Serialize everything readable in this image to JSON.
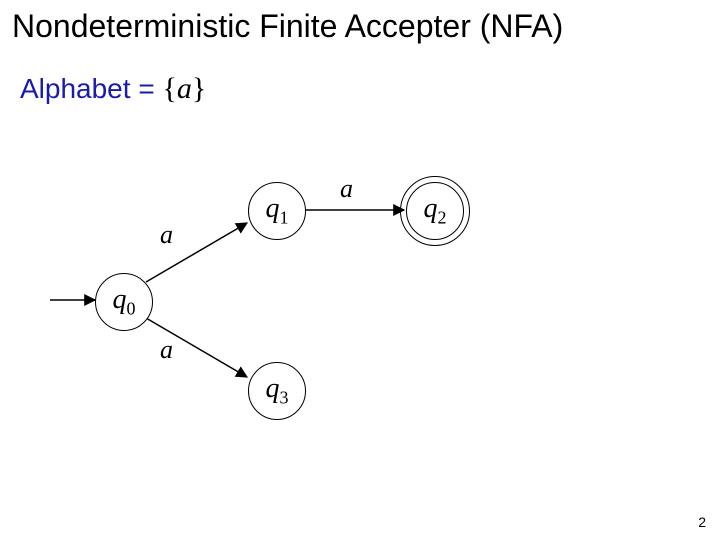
{
  "title": "Nondeterministic Finite Accepter (NFA)",
  "alphabet_label": "Alphabet =",
  "alphabet_set": "{a}",
  "page_number": "2",
  "nfa": {
    "states": [
      {
        "id": "q0",
        "label": "q",
        "sub": "0",
        "start": true,
        "accept": false
      },
      {
        "id": "q1",
        "label": "q",
        "sub": "1",
        "start": false,
        "accept": false
      },
      {
        "id": "q2",
        "label": "q",
        "sub": "2",
        "start": false,
        "accept": true
      },
      {
        "id": "q3",
        "label": "q",
        "sub": "3",
        "start": false,
        "accept": false
      }
    ],
    "transitions": [
      {
        "from": "q0",
        "to": "q1",
        "label": "a"
      },
      {
        "from": "q1",
        "to": "q2",
        "label": "a"
      },
      {
        "from": "q0",
        "to": "q3",
        "label": "a"
      }
    ]
  },
  "labels": {
    "edge_q0_q1": "a",
    "edge_q1_q2": "a",
    "edge_q0_q3": "a",
    "q0": "q",
    "q0_sub": "0",
    "q1": "q",
    "q1_sub": "1",
    "q2": "q",
    "q2_sub": "2",
    "q3": "q",
    "q3_sub": "3"
  }
}
